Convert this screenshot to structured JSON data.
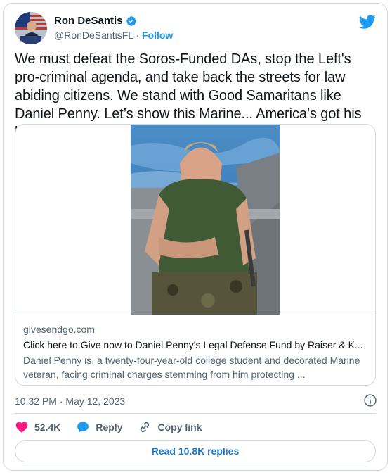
{
  "author": {
    "display_name": "Ron DeSantis",
    "handle": "@RonDeSantisFL",
    "separator": "·",
    "follow_label": "Follow"
  },
  "tweet": {
    "text": "We must defeat the Soros-Funded DAs, stop the Left's pro-criminal agenda, and take back the streets for law abiding citizens. We stand with Good Samaritans like Daniel Penny. Let’s show this Marine... America’s got his back."
  },
  "card": {
    "domain": "givesendgo.com",
    "title": "Click here to Give now to Daniel Penny's Legal Defense Fund by Raiser & K...",
    "description": "Daniel Penny is, a twenty-four-year-old college student and decorated Marine veteran, facing criminal charges stemming from him protecting ..."
  },
  "meta": {
    "timestamp": "10:32 PM · May 12, 2023"
  },
  "actions": {
    "likes": "52.4K",
    "reply_label": "Reply",
    "copy_link_label": "Copy link"
  },
  "read_replies_label": "Read 10.8K replies",
  "colors": {
    "accent": "#1d9bf0",
    "like": "#f91880",
    "text": "#0f1419",
    "secondary": "#536471",
    "border": "#cfd9de"
  }
}
